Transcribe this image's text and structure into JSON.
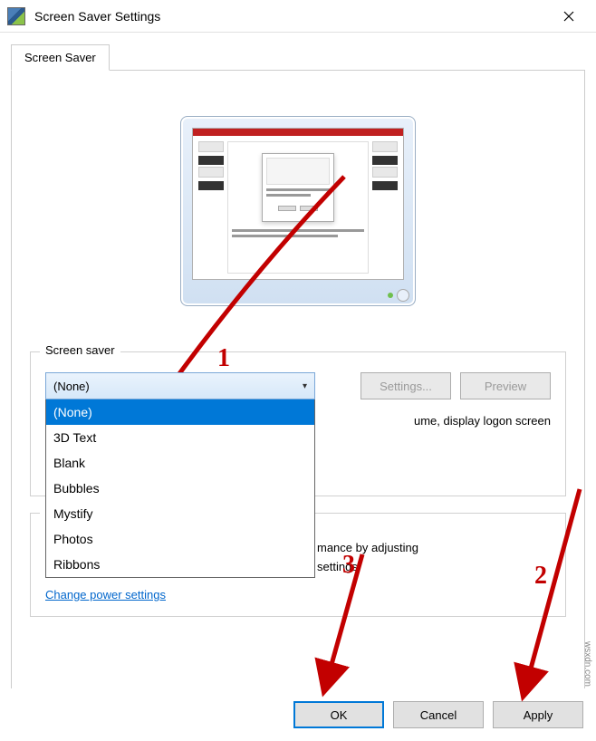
{
  "titlebar": {
    "title": "Screen Saver Settings"
  },
  "tab": {
    "label": "Screen Saver"
  },
  "group": {
    "label": "Screen saver",
    "dropdown": {
      "selected": "(None)",
      "options": [
        "(None)",
        "3D Text",
        "Blank",
        "Bubbles",
        "Mystify",
        "Photos",
        "Ribbons"
      ]
    },
    "settings_btn": "Settings...",
    "preview_btn": "Preview",
    "resume_text": "ume, display logon screen"
  },
  "power": {
    "text_line1": "mance by adjusting",
    "text_line2": "settings.",
    "link": "Change power settings"
  },
  "bottom": {
    "ok": "OK",
    "cancel": "Cancel",
    "apply": "Apply"
  },
  "annotations": {
    "n1": "1",
    "n2": "2",
    "n3": "3"
  },
  "watermark": "wsxdn.com"
}
